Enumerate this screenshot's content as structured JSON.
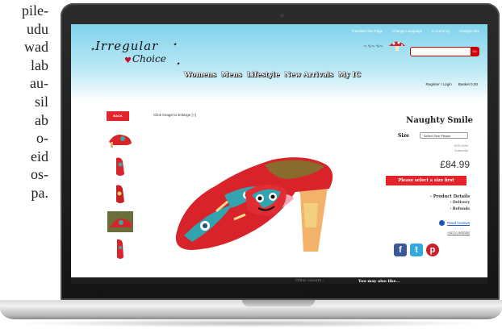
{
  "article_text": {
    "lines": [
      "pile-",
      "udu",
      "wad",
      "lab",
      "au-",
      "sil",
      "ab",
      "o-",
      "eid",
      "os-",
      "pa."
    ]
  },
  "site": {
    "topbar": [
      "Translate this Page",
      "Change Language",
      "£ Currency",
      "Change Site"
    ],
    "logo": {
      "line1": "Irregular",
      "line2": "Choice"
    },
    "nav": [
      "Womens",
      "Mens",
      "Lifestyle",
      "New Arrivals",
      "My IC"
    ],
    "search": {
      "button_label": "Go",
      "placeholder": ""
    },
    "account": {
      "register": "Register / Login",
      "basket": "Basket 0.00"
    }
  },
  "product": {
    "back_label": "BACK",
    "enlarge_hint": "Click Image to Enlarge [+]",
    "title": "Naughty Smile",
    "size_label": "Size",
    "size_placeholder": "Select Size Please",
    "ref_line1": "SOS 8494",
    "ref_line2": "Subscribe",
    "price": "£84.99",
    "add_button": "Please select a size first",
    "details_heading": "› Product Details",
    "delivery": "› Delivery",
    "refunds": "› Refunds",
    "reviews_link": "Read reviews",
    "wishlist_link": "Add to Wishlist"
  },
  "footer": {
    "other_colours": "Other colours...",
    "also_like": "You may also like..."
  },
  "colors": {
    "brand_red": "#e3242b",
    "header_blue": "#7fd3ec"
  },
  "icons": [
    "mushroom-icon",
    "facebook-icon",
    "twitter-icon",
    "pinterest-icon",
    "reviews-icon"
  ]
}
